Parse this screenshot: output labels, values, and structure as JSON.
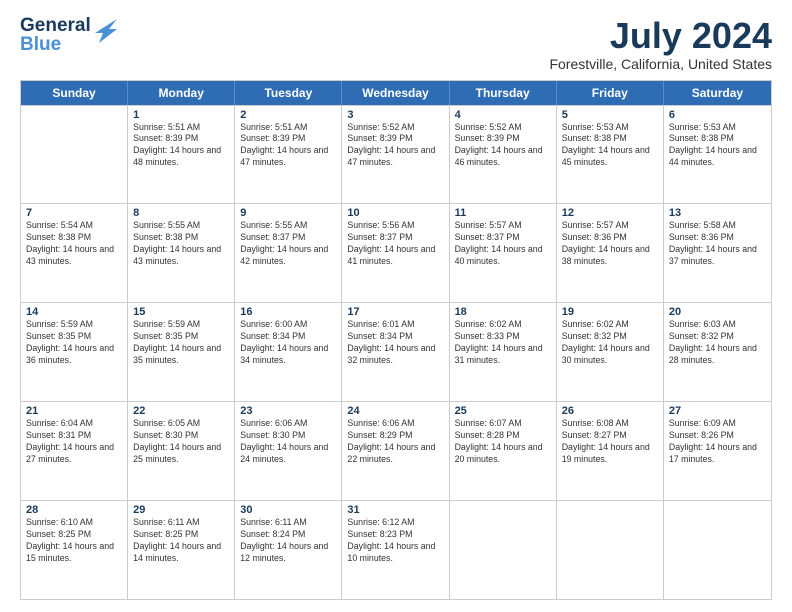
{
  "header": {
    "logo_line1": "General",
    "logo_line2": "Blue",
    "month_title": "July 2024",
    "location": "Forestville, California, United States"
  },
  "days_of_week": [
    "Sunday",
    "Monday",
    "Tuesday",
    "Wednesday",
    "Thursday",
    "Friday",
    "Saturday"
  ],
  "weeks": [
    [
      {
        "day": "",
        "sunrise": "",
        "sunset": "",
        "daylight": ""
      },
      {
        "day": "1",
        "sunrise": "Sunrise: 5:51 AM",
        "sunset": "Sunset: 8:39 PM",
        "daylight": "Daylight: 14 hours and 48 minutes."
      },
      {
        "day": "2",
        "sunrise": "Sunrise: 5:51 AM",
        "sunset": "Sunset: 8:39 PM",
        "daylight": "Daylight: 14 hours and 47 minutes."
      },
      {
        "day": "3",
        "sunrise": "Sunrise: 5:52 AM",
        "sunset": "Sunset: 8:39 PM",
        "daylight": "Daylight: 14 hours and 47 minutes."
      },
      {
        "day": "4",
        "sunrise": "Sunrise: 5:52 AM",
        "sunset": "Sunset: 8:39 PM",
        "daylight": "Daylight: 14 hours and 46 minutes."
      },
      {
        "day": "5",
        "sunrise": "Sunrise: 5:53 AM",
        "sunset": "Sunset: 8:38 PM",
        "daylight": "Daylight: 14 hours and 45 minutes."
      },
      {
        "day": "6",
        "sunrise": "Sunrise: 5:53 AM",
        "sunset": "Sunset: 8:38 PM",
        "daylight": "Daylight: 14 hours and 44 minutes."
      }
    ],
    [
      {
        "day": "7",
        "sunrise": "Sunrise: 5:54 AM",
        "sunset": "Sunset: 8:38 PM",
        "daylight": "Daylight: 14 hours and 43 minutes."
      },
      {
        "day": "8",
        "sunrise": "Sunrise: 5:55 AM",
        "sunset": "Sunset: 8:38 PM",
        "daylight": "Daylight: 14 hours and 43 minutes."
      },
      {
        "day": "9",
        "sunrise": "Sunrise: 5:55 AM",
        "sunset": "Sunset: 8:37 PM",
        "daylight": "Daylight: 14 hours and 42 minutes."
      },
      {
        "day": "10",
        "sunrise": "Sunrise: 5:56 AM",
        "sunset": "Sunset: 8:37 PM",
        "daylight": "Daylight: 14 hours and 41 minutes."
      },
      {
        "day": "11",
        "sunrise": "Sunrise: 5:57 AM",
        "sunset": "Sunset: 8:37 PM",
        "daylight": "Daylight: 14 hours and 40 minutes."
      },
      {
        "day": "12",
        "sunrise": "Sunrise: 5:57 AM",
        "sunset": "Sunset: 8:36 PM",
        "daylight": "Daylight: 14 hours and 38 minutes."
      },
      {
        "day": "13",
        "sunrise": "Sunrise: 5:58 AM",
        "sunset": "Sunset: 8:36 PM",
        "daylight": "Daylight: 14 hours and 37 minutes."
      }
    ],
    [
      {
        "day": "14",
        "sunrise": "Sunrise: 5:59 AM",
        "sunset": "Sunset: 8:35 PM",
        "daylight": "Daylight: 14 hours and 36 minutes."
      },
      {
        "day": "15",
        "sunrise": "Sunrise: 5:59 AM",
        "sunset": "Sunset: 8:35 PM",
        "daylight": "Daylight: 14 hours and 35 minutes."
      },
      {
        "day": "16",
        "sunrise": "Sunrise: 6:00 AM",
        "sunset": "Sunset: 8:34 PM",
        "daylight": "Daylight: 14 hours and 34 minutes."
      },
      {
        "day": "17",
        "sunrise": "Sunrise: 6:01 AM",
        "sunset": "Sunset: 8:34 PM",
        "daylight": "Daylight: 14 hours and 32 minutes."
      },
      {
        "day": "18",
        "sunrise": "Sunrise: 6:02 AM",
        "sunset": "Sunset: 8:33 PM",
        "daylight": "Daylight: 14 hours and 31 minutes."
      },
      {
        "day": "19",
        "sunrise": "Sunrise: 6:02 AM",
        "sunset": "Sunset: 8:32 PM",
        "daylight": "Daylight: 14 hours and 30 minutes."
      },
      {
        "day": "20",
        "sunrise": "Sunrise: 6:03 AM",
        "sunset": "Sunset: 8:32 PM",
        "daylight": "Daylight: 14 hours and 28 minutes."
      }
    ],
    [
      {
        "day": "21",
        "sunrise": "Sunrise: 6:04 AM",
        "sunset": "Sunset: 8:31 PM",
        "daylight": "Daylight: 14 hours and 27 minutes."
      },
      {
        "day": "22",
        "sunrise": "Sunrise: 6:05 AM",
        "sunset": "Sunset: 8:30 PM",
        "daylight": "Daylight: 14 hours and 25 minutes."
      },
      {
        "day": "23",
        "sunrise": "Sunrise: 6:06 AM",
        "sunset": "Sunset: 8:30 PM",
        "daylight": "Daylight: 14 hours and 24 minutes."
      },
      {
        "day": "24",
        "sunrise": "Sunrise: 6:06 AM",
        "sunset": "Sunset: 8:29 PM",
        "daylight": "Daylight: 14 hours and 22 minutes."
      },
      {
        "day": "25",
        "sunrise": "Sunrise: 6:07 AM",
        "sunset": "Sunset: 8:28 PM",
        "daylight": "Daylight: 14 hours and 20 minutes."
      },
      {
        "day": "26",
        "sunrise": "Sunrise: 6:08 AM",
        "sunset": "Sunset: 8:27 PM",
        "daylight": "Daylight: 14 hours and 19 minutes."
      },
      {
        "day": "27",
        "sunrise": "Sunrise: 6:09 AM",
        "sunset": "Sunset: 8:26 PM",
        "daylight": "Daylight: 14 hours and 17 minutes."
      }
    ],
    [
      {
        "day": "28",
        "sunrise": "Sunrise: 6:10 AM",
        "sunset": "Sunset: 8:25 PM",
        "daylight": "Daylight: 14 hours and 15 minutes."
      },
      {
        "day": "29",
        "sunrise": "Sunrise: 6:11 AM",
        "sunset": "Sunset: 8:25 PM",
        "daylight": "Daylight: 14 hours and 14 minutes."
      },
      {
        "day": "30",
        "sunrise": "Sunrise: 6:11 AM",
        "sunset": "Sunset: 8:24 PM",
        "daylight": "Daylight: 14 hours and 12 minutes."
      },
      {
        "day": "31",
        "sunrise": "Sunrise: 6:12 AM",
        "sunset": "Sunset: 8:23 PM",
        "daylight": "Daylight: 14 hours and 10 minutes."
      },
      {
        "day": "",
        "sunrise": "",
        "sunset": "",
        "daylight": ""
      },
      {
        "day": "",
        "sunrise": "",
        "sunset": "",
        "daylight": ""
      },
      {
        "day": "",
        "sunrise": "",
        "sunset": "",
        "daylight": ""
      }
    ]
  ]
}
